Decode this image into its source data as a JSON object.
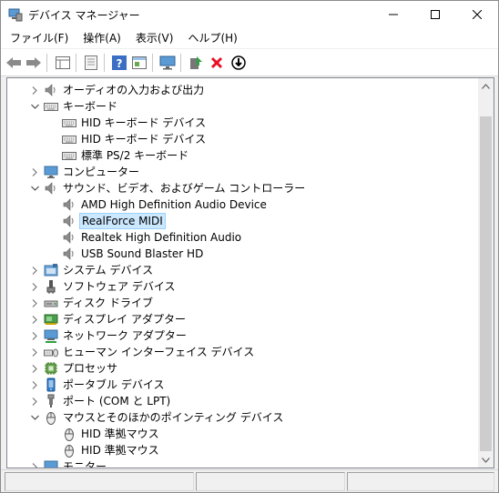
{
  "window": {
    "title": "デバイス マネージャー"
  },
  "menu": [
    {
      "label": "ファイル(F)"
    },
    {
      "label": "操作(A)"
    },
    {
      "label": "表示(V)"
    },
    {
      "label": "ヘルプ(H)"
    }
  ],
  "tree": [
    {
      "label": "オーディオの入力および出力",
      "level": 0,
      "expander": "collapsed",
      "icon": "speaker-icon"
    },
    {
      "label": "キーボード",
      "level": 0,
      "expander": "expanded",
      "icon": "keyboard-icon"
    },
    {
      "label": "HID キーボード デバイス",
      "level": 1,
      "expander": "none",
      "icon": "keyboard-icon"
    },
    {
      "label": "HID キーボード デバイス",
      "level": 1,
      "expander": "none",
      "icon": "keyboard-icon"
    },
    {
      "label": "標準 PS/2 キーボード",
      "level": 1,
      "expander": "none",
      "icon": "keyboard-icon"
    },
    {
      "label": "コンピューター",
      "level": 0,
      "expander": "collapsed",
      "icon": "monitor-icon"
    },
    {
      "label": "サウンド、ビデオ、およびゲーム コントローラー",
      "level": 0,
      "expander": "expanded",
      "icon": "speaker-icon"
    },
    {
      "label": "AMD High Definition Audio Device",
      "level": 1,
      "expander": "none",
      "icon": "speaker-icon"
    },
    {
      "label": "RealForce MIDI",
      "level": 1,
      "expander": "none",
      "icon": "speaker-icon",
      "selected": true
    },
    {
      "label": "Realtek High Definition Audio",
      "level": 1,
      "expander": "none",
      "icon": "speaker-icon"
    },
    {
      "label": "USB Sound Blaster HD",
      "level": 1,
      "expander": "none",
      "icon": "speaker-icon"
    },
    {
      "label": "システム デバイス",
      "level": 0,
      "expander": "collapsed",
      "icon": "system-folder-icon"
    },
    {
      "label": "ソフトウェア デバイス",
      "level": 0,
      "expander": "collapsed",
      "icon": "software-device-icon"
    },
    {
      "label": "ディスク ドライブ",
      "level": 0,
      "expander": "collapsed",
      "icon": "disk-drive-icon"
    },
    {
      "label": "ディスプレイ アダプター",
      "level": 0,
      "expander": "collapsed",
      "icon": "display-adapter-icon"
    },
    {
      "label": "ネットワーク アダプター",
      "level": 0,
      "expander": "collapsed",
      "icon": "network-adapter-icon"
    },
    {
      "label": "ヒューマン インターフェイス デバイス",
      "level": 0,
      "expander": "collapsed",
      "icon": "hid-icon"
    },
    {
      "label": "プロセッサ",
      "level": 0,
      "expander": "collapsed",
      "icon": "processor-icon"
    },
    {
      "label": "ポータブル デバイス",
      "level": 0,
      "expander": "collapsed",
      "icon": "portable-device-icon"
    },
    {
      "label": "ポート (COM と LPT)",
      "level": 0,
      "expander": "collapsed",
      "icon": "port-icon"
    },
    {
      "label": "マウスとそのほかのポインティング デバイス",
      "level": 0,
      "expander": "expanded",
      "icon": "mouse-icon"
    },
    {
      "label": "HID 準拠マウス",
      "level": 1,
      "expander": "none",
      "icon": "mouse-icon"
    },
    {
      "label": "HID 準拠マウス",
      "level": 1,
      "expander": "none",
      "icon": "mouse-icon"
    },
    {
      "label": "モニター",
      "level": 0,
      "expander": "collapsed",
      "icon": "monitor-icon"
    }
  ],
  "colors": {
    "selection": "#cce8ff",
    "selection_border": "#99d1ff",
    "delete_red": "#e81123"
  }
}
